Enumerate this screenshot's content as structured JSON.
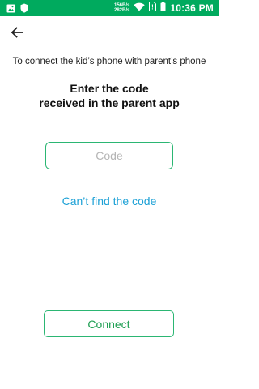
{
  "status_bar": {
    "net_speed_up": "156B/s",
    "net_speed_down": "282B/s",
    "time": "10:36 PM",
    "icons": [
      "image-icon",
      "shield-icon",
      "wifi-icon",
      "no-sim-icon",
      "battery-icon"
    ],
    "background_color": "#00aa5e"
  },
  "header": {
    "back_icon": "arrow-left-icon"
  },
  "main": {
    "subtitle": "To connect the kid’s phone with parent’s phone",
    "heading_line1": "Enter the code",
    "heading_line2": "received in the parent app",
    "code_input": {
      "placeholder": "Code",
      "value": ""
    },
    "cant_find_link": "Can’t find the code",
    "connect_button": "Connect"
  },
  "colors": {
    "accent_green": "#2bb673",
    "link_blue": "#1da1d6",
    "button_text_green": "#1e9e52"
  }
}
